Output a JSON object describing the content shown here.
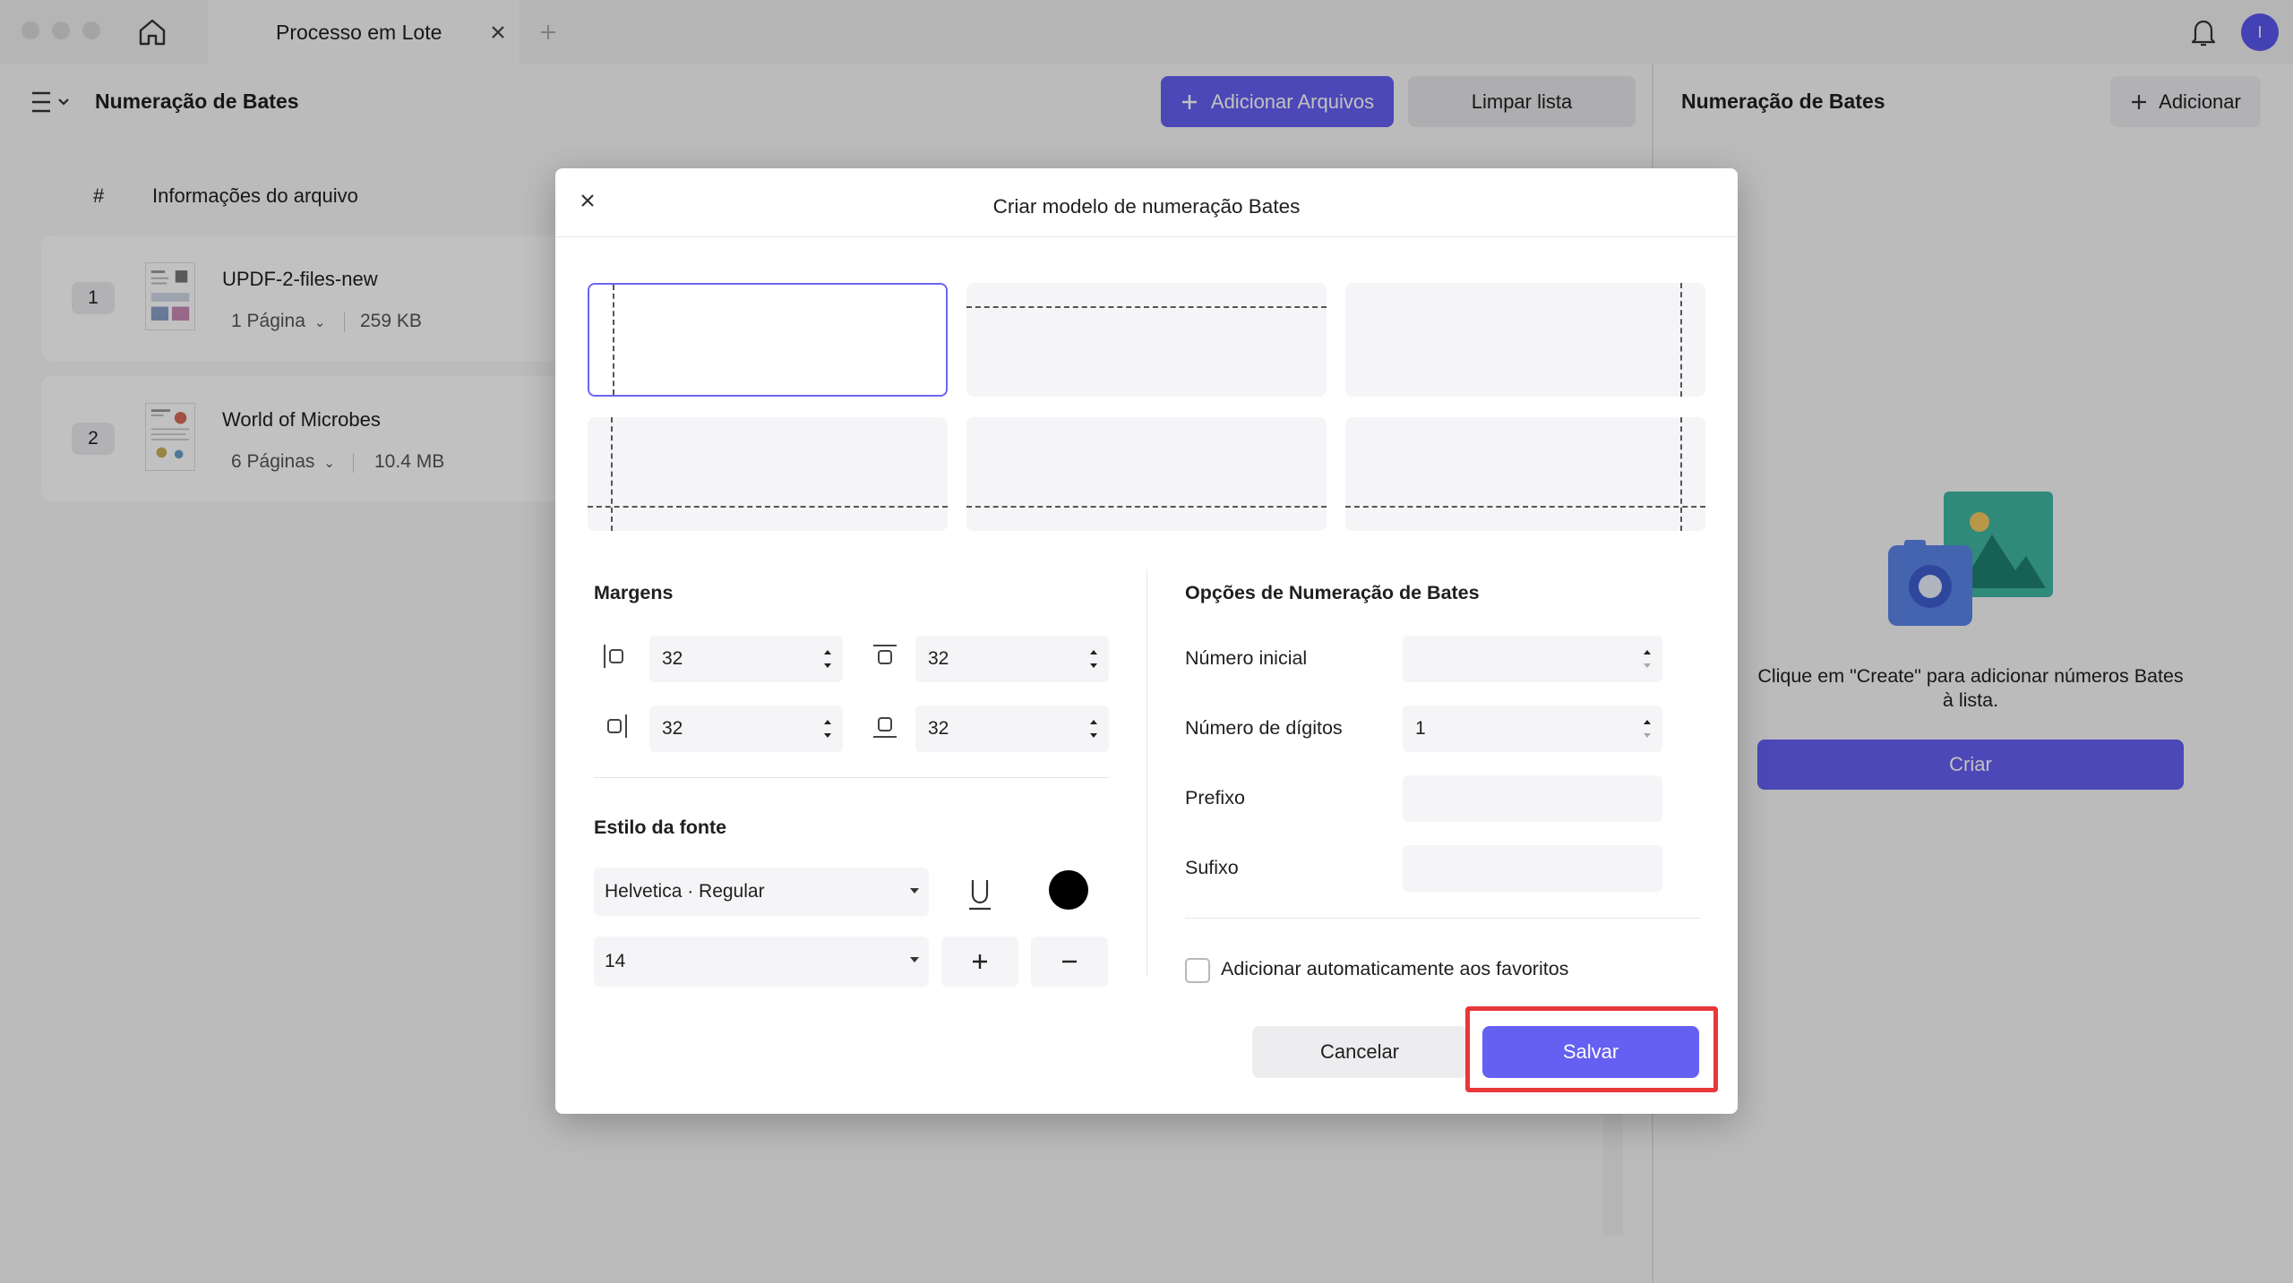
{
  "window": {
    "tab_title": "Processo em Lote",
    "avatar_letter": "I"
  },
  "toolbar": {
    "title": "Numeração de Bates",
    "add_files_label": "Adicionar Arquivos",
    "clear_list_label": "Limpar lista"
  },
  "file_list": {
    "col_number": "#",
    "col_info": "Informações do arquivo",
    "files": [
      {
        "index": "1",
        "name": "UPDF-2-files-new",
        "pages": "1 Página",
        "size": "259 KB"
      },
      {
        "index": "2",
        "name": "World of Microbes",
        "pages": "6 Páginas",
        "size": "10.4 MB"
      }
    ]
  },
  "right_panel": {
    "title": "Numeração de Bates",
    "add_label": "Adicionar",
    "empty_text": "Clique em \"Create\" para adicionar números Bates à lista.",
    "create_label": "Criar"
  },
  "dialog": {
    "title": "Criar modelo de numeração Bates",
    "selected_position": "top-left",
    "margins": {
      "title": "Margens",
      "left": "32",
      "top": "32",
      "right": "32",
      "bottom": "32"
    },
    "font": {
      "title": "Estilo da fonte",
      "family": "Helvetica · Regular",
      "size": "14",
      "color": "#000000"
    },
    "options": {
      "title": "Opções de Numeração de Bates",
      "start_number_label": "Número inicial",
      "start_number_value": "",
      "digits_label": "Número de dígitos",
      "digits_value": "1",
      "prefix_label": "Prefixo",
      "prefix_value": "",
      "suffix_label": "Sufixo",
      "suffix_value": ""
    },
    "favorites_label": "Adicionar automaticamente aos favoritos",
    "favorites_checked": false,
    "cancel_label": "Cancelar",
    "save_label": "Salvar"
  },
  "colors": {
    "accent": "#6560f2",
    "highlight": "#e8373a"
  }
}
